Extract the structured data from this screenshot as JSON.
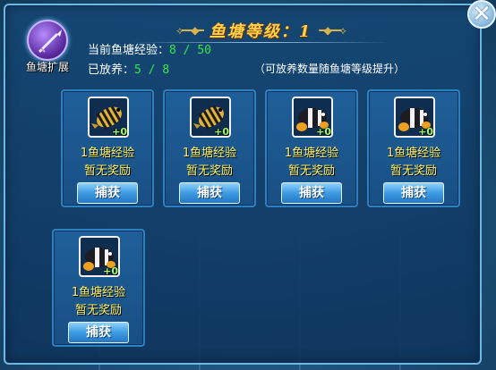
{
  "header": {
    "title": "鱼塘等级：1"
  },
  "expand": {
    "label": "鱼塘扩展"
  },
  "stats": {
    "exp_label": "当前鱼塘经验：",
    "exp_value": "8 / 50",
    "stock_label": "已放养：",
    "stock_value": "5 / 8",
    "hint": "（可放养数量随鱼塘等级提升）"
  },
  "slots": [
    {
      "fish_icon": "striped-fish-icon",
      "plus": "+0",
      "exp": "1鱼塘经验",
      "reward": "暂无奖励",
      "button": "捕获"
    },
    {
      "fish_icon": "striped-fish-icon",
      "plus": "+0",
      "exp": "1鱼塘经验",
      "reward": "暂无奖励",
      "button": "捕获"
    },
    {
      "fish_icon": "clownfish-icon",
      "plus": "+0",
      "exp": "1鱼塘经验",
      "reward": "暂无奖励",
      "button": "捕获"
    },
    {
      "fish_icon": "clownfish-icon",
      "plus": "+0",
      "exp": "1鱼塘经验",
      "reward": "暂无奖励",
      "button": "捕获"
    },
    {
      "fish_icon": "clownfish-icon",
      "plus": "+0",
      "exp": "1鱼塘经验",
      "reward": "暂无奖励",
      "button": "捕获"
    }
  ],
  "colors": {
    "title": "#ffd24a",
    "value": "#33e64a",
    "reward_text": "#fff36a"
  }
}
